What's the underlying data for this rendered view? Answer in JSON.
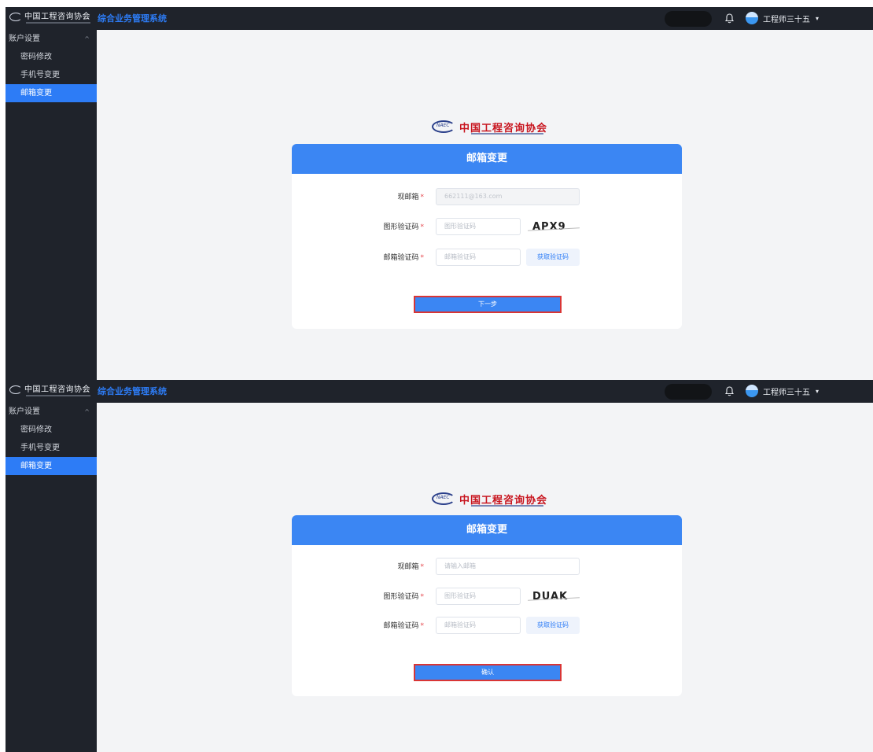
{
  "header": {
    "logo_text": "中国工程咨询协会",
    "app_title": "综合业务管理系统",
    "user_name": "工程师三十五",
    "user_caret": "▾"
  },
  "sidebar": {
    "group_label": "账户设置",
    "group_chevron": "^",
    "items": [
      {
        "label": "密码修改"
      },
      {
        "label": "手机号变更"
      },
      {
        "label": "邮箱变更"
      }
    ]
  },
  "brand_logo": {
    "tag": "NAEC",
    "name": "中国工程咨询协会"
  },
  "screen1": {
    "card_title": "邮箱变更",
    "email_label": "现邮箱",
    "email_value": "662111@163.com",
    "captcha_label": "图形验证码",
    "captcha_placeholder": "图形验证码",
    "captcha_text": "APX9",
    "code_label": "邮箱验证码",
    "code_placeholder": "邮箱验证码",
    "get_code_label": "获取验证码",
    "submit_label": "下一步"
  },
  "screen2": {
    "card_title": "邮箱变更",
    "email_label": "现邮箱",
    "email_placeholder": "请输入邮箱",
    "captcha_label": "图形验证码",
    "captcha_placeholder": "图形验证码",
    "captcha_text": "DUAK",
    "code_label": "邮箱验证码",
    "code_placeholder": "邮箱验证码",
    "get_code_label": "获取验证码",
    "submit_label": "确认"
  },
  "required_mark": "*",
  "colors": {
    "sidebar_bg": "#1f232b",
    "accent": "#2d7cf6",
    "card_header": "#3b86f3",
    "required": "#e5484d",
    "submit_border": "#d93535"
  },
  "icons": {
    "notification": "bell-icon",
    "avatar": "avatar-icon",
    "collapse": "chevron-up-icon"
  }
}
